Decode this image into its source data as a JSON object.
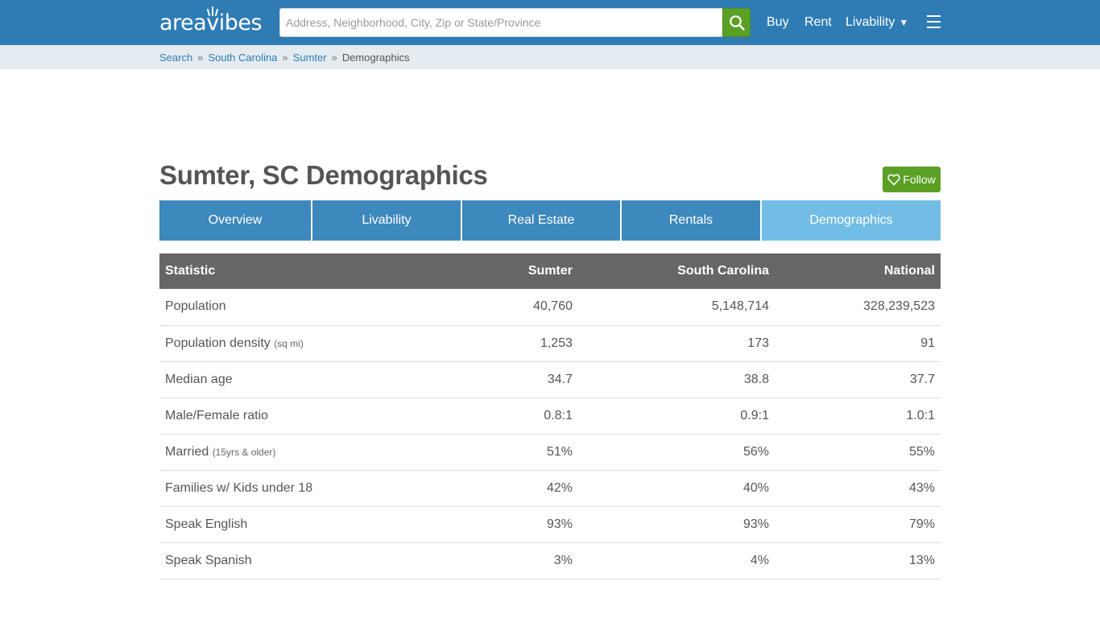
{
  "header": {
    "logo": "areavibes",
    "search": {
      "placeholder": "Address, Neighborhood, City, Zip or State/Province",
      "value": ""
    },
    "nav": {
      "buy": "Buy",
      "rent": "Rent",
      "livability": "Livability",
      "livability_caret": "▼"
    },
    "icons": [
      "search-icon",
      "menu-icon"
    ]
  },
  "breadcrumb": {
    "items": [
      "Search",
      "South Carolina",
      "Sumter"
    ],
    "current": "Demographics",
    "separator": "»"
  },
  "page": {
    "title": "Sumter, SC Demographics",
    "follow_label": "Follow"
  },
  "tabs": [
    {
      "label": "Overview",
      "active": false
    },
    {
      "label": "Livability",
      "active": false
    },
    {
      "label": "Real Estate",
      "active": false
    },
    {
      "label": "Rentals",
      "active": false
    },
    {
      "label": "Demographics",
      "active": true
    }
  ],
  "table": {
    "headers": [
      "Statistic",
      "Sumter",
      "South Carolina",
      "National"
    ],
    "rows": [
      {
        "stat": "Population",
        "note": "",
        "values": [
          "40,760",
          "5,148,714",
          "328,239,523"
        ]
      },
      {
        "stat": "Population density",
        "note": "(sq mi)",
        "values": [
          "1,253",
          "173",
          "91"
        ]
      },
      {
        "stat": "Median age",
        "note": "",
        "values": [
          "34.7",
          "38.8",
          "37.7"
        ]
      },
      {
        "stat": "Male/Female ratio",
        "note": "",
        "values": [
          "0.8:1",
          "0.9:1",
          "1.0:1"
        ]
      },
      {
        "stat": "Married",
        "note": "(15yrs & older)",
        "values": [
          "51%",
          "56%",
          "55%"
        ]
      },
      {
        "stat": "Families w/ Kids under 18",
        "note": "",
        "values": [
          "42%",
          "40%",
          "43%"
        ]
      },
      {
        "stat": "Speak English",
        "note": "",
        "values": [
          "93%",
          "93%",
          "79%"
        ]
      },
      {
        "stat": "Speak Spanish",
        "note": "",
        "values": [
          "3%",
          "4%",
          "13%"
        ]
      }
    ]
  },
  "colors": {
    "header_bg": "#2f7cb4",
    "accent_green": "#5aa025",
    "tab_bg": "#3d88bd",
    "tab_active_bg": "#72bde6",
    "table_header_bg": "#666666"
  }
}
